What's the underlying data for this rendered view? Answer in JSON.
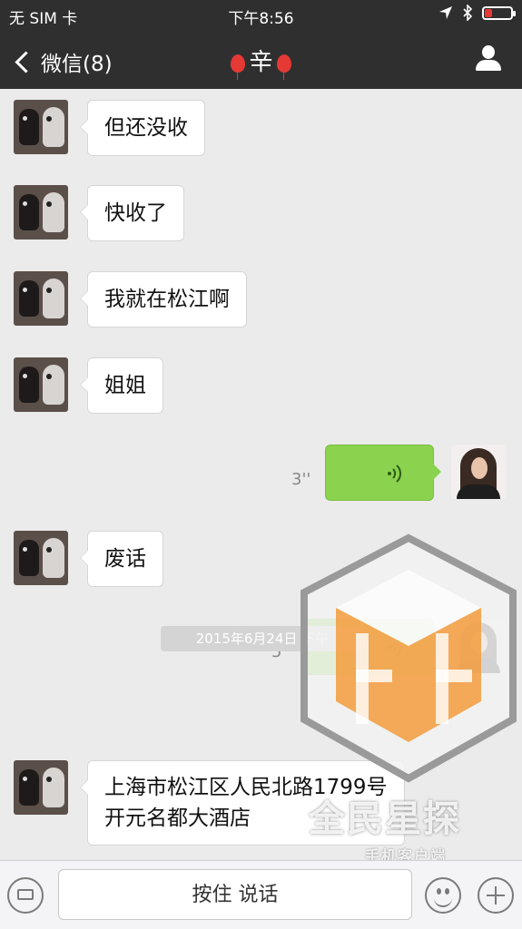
{
  "statusbar": {
    "carrier": "无 SIM 卡",
    "time": "下午8:56",
    "battery_level": 0.2
  },
  "header": {
    "back_label": "微信(8)",
    "title": "辛",
    "title_icon": "balloon-icon",
    "right_icon": "contact-icon"
  },
  "messages": [
    {
      "side": "left",
      "text": "但还没收"
    },
    {
      "side": "left",
      "text": "快收了"
    },
    {
      "side": "left",
      "text": "我就在松江啊"
    },
    {
      "side": "left",
      "text": "姐姐"
    },
    {
      "side": "right",
      "type": "voice",
      "duration": "3''"
    },
    {
      "side": "left",
      "text": "废话"
    },
    {
      "side": "right",
      "type": "voice",
      "duration": "5''"
    },
    {
      "side": "left",
      "line1": "上海市松江区人民北路1799号",
      "line2": "开元名都大酒店"
    }
  ],
  "timestamp": "2015年6月24日 下午",
  "watermark": {
    "main": "全民星探",
    "sub": "手机客户端"
  },
  "inputbar": {
    "talk_label": "按住 说话"
  },
  "colors": {
    "nav_bg": "#2f2f2f",
    "chat_bg": "#ebebeb",
    "sent_bubble": "#8bd34e"
  }
}
